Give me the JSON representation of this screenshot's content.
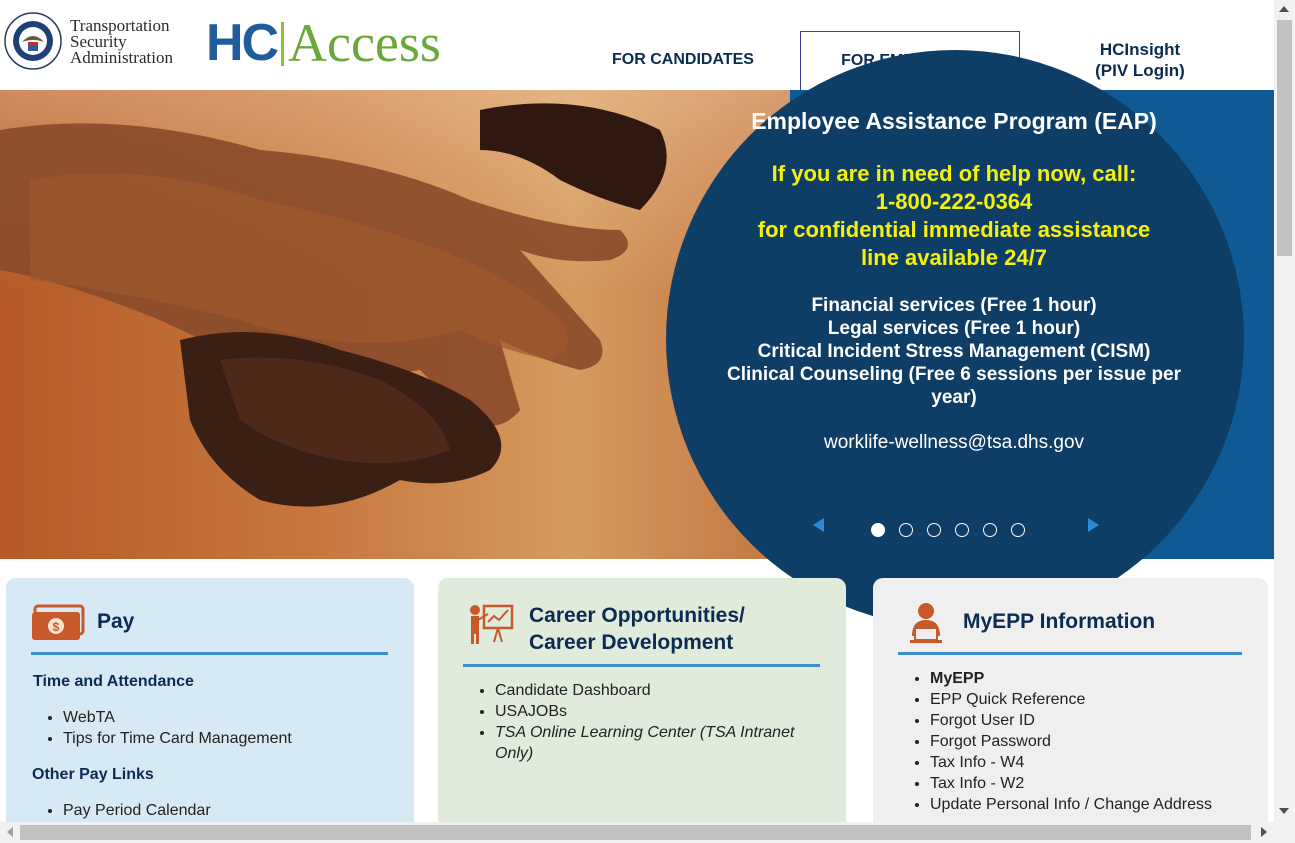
{
  "header": {
    "agency_line1": "Transportation",
    "agency_line2": "Security",
    "agency_line3": "Administration",
    "brand_hc": "HC",
    "brand_access": "Access",
    "nav": {
      "candidates": "FOR CANDIDATES",
      "employees": "FOR EMPLOYEES",
      "hcinsight_line1": "HCInsight",
      "hcinsight_line2": "(PIV Login)"
    }
  },
  "hero": {
    "title": "Employee Assistance Program (EAP)",
    "help_line1": "If you are in need of help now, call:",
    "help_phone": "1-800-222-0364",
    "help_line3": "for confidential immediate assistance",
    "help_line4": "line available 24/7",
    "services": [
      "Financial services (Free 1 hour)",
      "Legal services (Free 1 hour)",
      "Critical Incident Stress Management (CISM)",
      "Clinical Counseling (Free 6 sessions per issue per year)"
    ],
    "email": "worklife-wellness@tsa.dhs.gov",
    "carousel": {
      "slide_count": 6,
      "active_index": 0
    }
  },
  "cards": {
    "pay": {
      "title": "Pay",
      "section1_title": "Time and Attendance",
      "section1_items": [
        "WebTA",
        "Tips for Time Card Management"
      ],
      "section2_title": "Other Pay Links",
      "section2_items": [
        "Pay Period Calendar"
      ]
    },
    "career": {
      "title_line1": "Career Opportunities/",
      "title_line2": "Career Development",
      "items": [
        "Candidate Dashboard",
        "USAJOBs",
        "TSA Online Learning Center (TSA Intranet Only)"
      ]
    },
    "myepp": {
      "title": "MyEPP Information",
      "items": [
        "MyEPP",
        "EPP Quick Reference",
        "Forgot User ID",
        "Forgot Password",
        "Tax Info - W4",
        "Tax Info - W2",
        "Update Personal Info / Change Address"
      ]
    }
  },
  "colors": {
    "navy_text": "#0b2b52",
    "eap_yellow": "#f5f20a",
    "eap_circle": "#0e3e66",
    "accent_blue": "#3d8fd0",
    "icon_orange": "#c8592a"
  }
}
